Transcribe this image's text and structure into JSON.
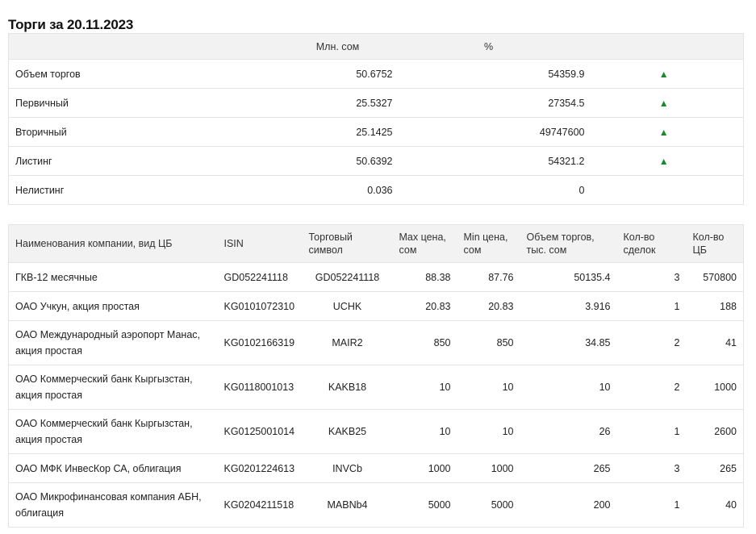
{
  "title": "Торги за 20.11.2023",
  "summary": {
    "headers": [
      "",
      "Млн. сом",
      "%",
      ""
    ],
    "rows": [
      {
        "label": "Объем торгов",
        "mln": "50.6752",
        "pct": "54359.9",
        "arrow": "▲"
      },
      {
        "label": "Первичный",
        "mln": "25.5327",
        "pct": "27354.5",
        "arrow": "▲"
      },
      {
        "label": "Вторичный",
        "mln": "25.1425",
        "pct": "49747600",
        "arrow": "▲"
      },
      {
        "label": "Листинг",
        "mln": "50.6392",
        "pct": "54321.2",
        "arrow": "▲"
      },
      {
        "label": "Нелистинг",
        "mln": "0.036",
        "pct": "0",
        "arrow": ""
      }
    ]
  },
  "trades": {
    "headers": {
      "name": "Наименования компании, вид ЦБ",
      "isin": "ISIN",
      "symbol": "Торговый символ",
      "max": "Max цена, сом",
      "min": "Min цена, сом",
      "volume": "Объем торгов, тыс. сом",
      "deals": "Кол-во сделок",
      "count": "Кол-во ЦБ"
    },
    "rows": [
      {
        "name": "ГКВ-12 месячные",
        "isin": "GD052241118",
        "symbol": "GD052241118",
        "max": "88.38",
        "min": "87.76",
        "volume": "50135.4",
        "deals": "3",
        "count": "570800"
      },
      {
        "name": "ОАО Учкун, акция простая",
        "isin": "KG0101072310",
        "symbol": "UCHK",
        "max": "20.83",
        "min": "20.83",
        "volume": "3.916",
        "deals": "1",
        "count": "188"
      },
      {
        "name": "ОАО Международный аэропорт Манас, акция простая",
        "isin": "KG0102166319",
        "symbol": "MAIR2",
        "max": "850",
        "min": "850",
        "volume": "34.85",
        "deals": "2",
        "count": "41"
      },
      {
        "name": "ОАО Коммерческий банк Кыргызстан, акция простая",
        "isin": "KG0118001013",
        "symbol": "KAKB18",
        "max": "10",
        "min": "10",
        "volume": "10",
        "deals": "2",
        "count": "1000"
      },
      {
        "name": "ОАО Коммерческий банк Кыргызстан, акция простая",
        "isin": "KG0125001014",
        "symbol": "KAKB25",
        "max": "10",
        "min": "10",
        "volume": "26",
        "deals": "1",
        "count": "2600"
      },
      {
        "name": "ОАО МФК ИнвесКор СА, облигация",
        "isin": "KG0201224613",
        "symbol": "INVCb",
        "max": "1000",
        "min": "1000",
        "volume": "265",
        "deals": "3",
        "count": "265"
      },
      {
        "name": "ОАО Микрофинансовая компания АБН, облигация",
        "isin": "KG0204211518",
        "symbol": "MABNb4",
        "max": "5000",
        "min": "5000",
        "volume": "200",
        "deals": "1",
        "count": "40"
      }
    ]
  },
  "colors": {
    "arrow_up": "#1a8a2b",
    "header_bg": "#f2f2f2",
    "border": "#e3e3e3"
  }
}
